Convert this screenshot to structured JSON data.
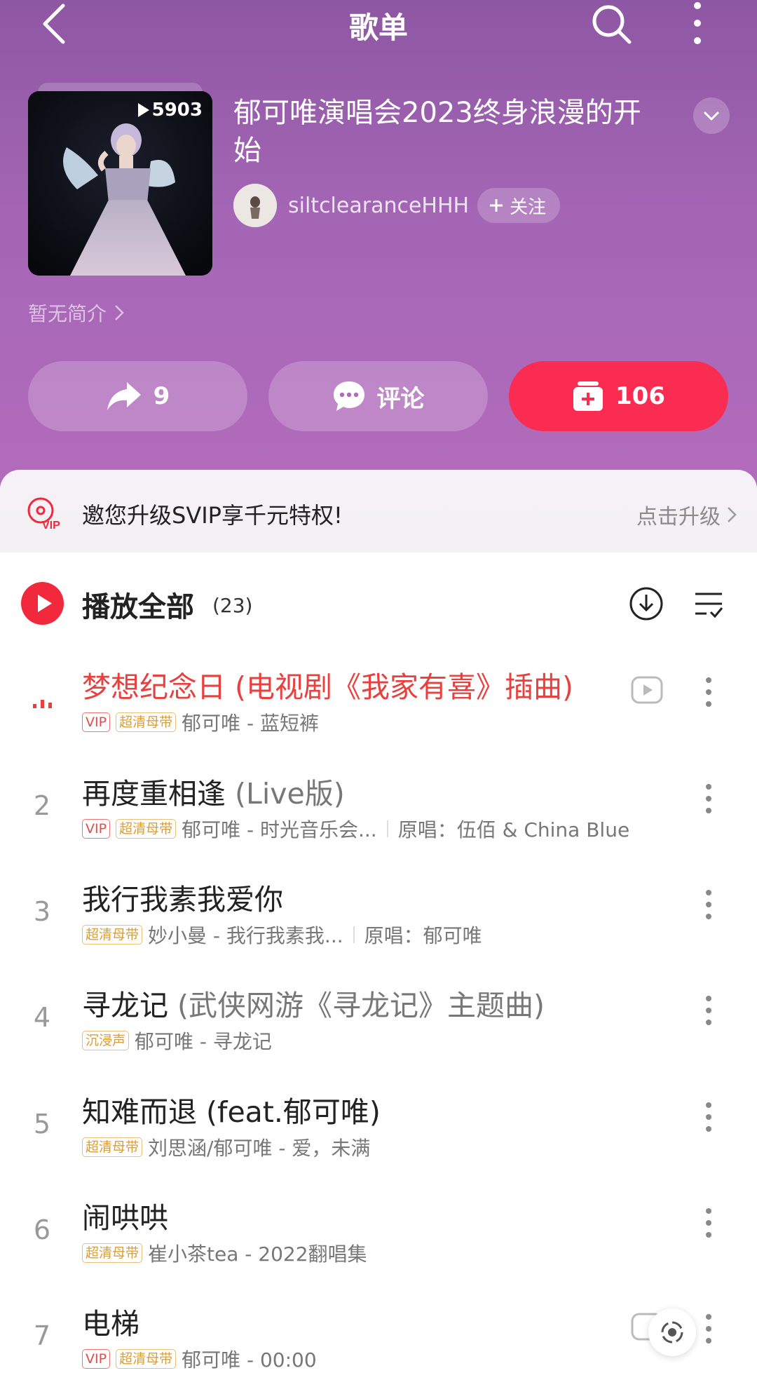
{
  "topbar": {
    "title": "歌单"
  },
  "playlist": {
    "title": "郁可唯演唱会2023终身浪漫的开始",
    "play_count": "5903",
    "creator": "siltclearanceHHH",
    "follow_label": "关注",
    "description": "暂无简介"
  },
  "actions": {
    "share_count": "9",
    "comment_label": "评论",
    "collect_count": "106"
  },
  "vip_banner": {
    "text": "邀您升级SVIP享千元特权!",
    "link": "点击升级"
  },
  "list_header": {
    "play_all": "播放全部",
    "count": "(23)"
  },
  "songs": [
    {
      "index": "",
      "title": "梦想纪念日 (电视剧《我家有喜》插曲)",
      "subtitle": "",
      "tags": [
        "VIP",
        "超清母带"
      ],
      "meta": "郁可唯 - 蓝短裤",
      "original": "",
      "playing": true
    },
    {
      "index": "2",
      "title": "再度重相逢",
      "subtitle": " (Live版)",
      "tags": [
        "VIP",
        "超清母带"
      ],
      "meta": "郁可唯 - 时光音乐会...",
      "original": "原唱：伍佰 & China Blue"
    },
    {
      "index": "3",
      "title": "我行我素我爱你",
      "subtitle": "",
      "tags": [
        "超清母带"
      ],
      "meta": "妙小曼 - 我行我素我...",
      "original": "原唱：郁可唯"
    },
    {
      "index": "4",
      "title": "寻龙记",
      "subtitle": " (武侠网游《寻龙记》主题曲)",
      "tags": [
        "沉浸声"
      ],
      "meta": "郁可唯 - 寻龙记",
      "original": ""
    },
    {
      "index": "5",
      "title": "知难而退 (feat.郁可唯)",
      "subtitle": "",
      "tags": [
        "超清母带"
      ],
      "meta": "刘思涵/郁可唯 - 爱，未满",
      "original": ""
    },
    {
      "index": "6",
      "title": "闹哄哄",
      "subtitle": "",
      "tags": [
        "超清母带"
      ],
      "meta": "崔小茶tea - 2022翻唱集",
      "original": ""
    },
    {
      "index": "7",
      "title": "电梯",
      "subtitle": "",
      "tags": [
        "VIP",
        "超清母带"
      ],
      "meta": "郁可唯 - 00:00",
      "original": ""
    }
  ],
  "colors": {
    "hero_top": "#8e57a3",
    "hero_bottom": "#b46cbc",
    "accent_red": "#fa2c52",
    "playing_text": "#e8403e"
  }
}
